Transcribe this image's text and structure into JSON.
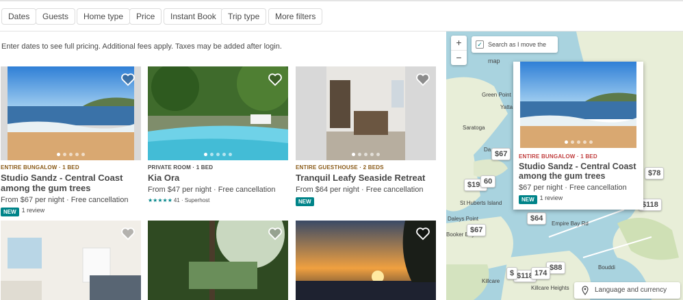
{
  "filters": [
    "Dates",
    "Guests",
    "Home type",
    "Price",
    "Instant Book",
    "Trip type",
    "More filters"
  ],
  "notice": "Enter dates to see full pricing. Additional fees apply. Taxes may be added after login.",
  "listings": [
    {
      "type": "ENTIRE BUNGALOW · 1 BED",
      "title": "Studio Sandz - Central Coast among the gum trees",
      "price": "From $67 per night · Free cancellation",
      "badge": "NEW",
      "reviews": "1 review",
      "type_color": "#8a5a17"
    },
    {
      "type": "PRIVATE ROOM · 1 BED",
      "title": "Kia Ora",
      "price": "From $47 per night · Free cancellation",
      "stars": "★★★★★",
      "rating_text": "41 · Superhost",
      "type_color": "#484848"
    },
    {
      "type": "ENTIRE GUESTHOUSE · 2 BEDS",
      "title": "Tranquil Leafy Seaside Retreat",
      "price": "From $64 per night · Free cancellation",
      "badge": "NEW",
      "type_color": "#8a5a17"
    }
  ],
  "map": {
    "zoom_in": "+",
    "zoom_out": "−",
    "search_as_move": "Search as I move the map",
    "search_as_move_checked": "✓",
    "towns": [
      "Green Point",
      "Yatta",
      "Saratoga",
      "St Huberts Island",
      "Daleys Point",
      "Booker Bay",
      "Killcare",
      "Killcare Heights",
      "Bouddi",
      "Empire Bay Rd",
      "Da"
    ],
    "pins": [
      "$67",
      "$198",
      "60",
      "$78",
      "$118",
      "$64",
      "$67",
      "$88",
      "$118",
      "174",
      "$"
    ],
    "popup": {
      "type": "ENTIRE BUNGALOW · 1 BED",
      "title": "Studio Sandz - Central Coast among the gum trees",
      "price": "$67 per night · Free cancellation",
      "badge": "NEW",
      "reviews": "1 review"
    },
    "language_button": "Language and currency"
  },
  "colors": {
    "accent": "#008489",
    "map_water": "#a9d3df",
    "map_land": "#e8eed8"
  }
}
